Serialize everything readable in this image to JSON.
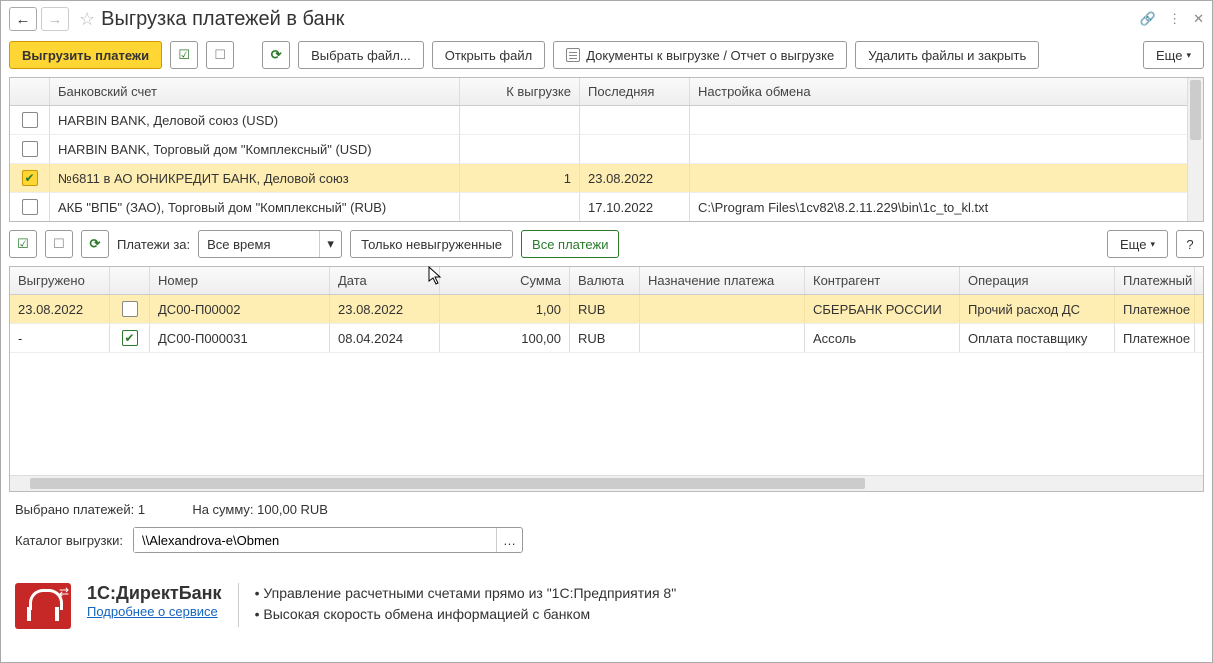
{
  "title": "Выгрузка платежей в банк",
  "toolbar": {
    "upload": "Выгрузить платежи",
    "select_file": "Выбрать файл...",
    "open_file": "Открыть файл",
    "docs_report": "Документы к выгрузке / Отчет о выгрузке",
    "delete_close": "Удалить файлы и закрыть",
    "more": "Еще"
  },
  "accounts": {
    "headers": {
      "acc": "Банковский счет",
      "upload": "К выгрузке",
      "last": "Последняя",
      "cfg": "Настройка обмена"
    },
    "rows": [
      {
        "checked": false,
        "acc": "HARBIN BANK, Деловой союз (USD)",
        "upload": "",
        "last": "",
        "cfg": ""
      },
      {
        "checked": false,
        "acc": "HARBIN BANK, Торговый дом \"Комплексный\" (USD)",
        "upload": "",
        "last": "",
        "cfg": ""
      },
      {
        "checked": true,
        "acc": "№6811 в АО ЮНИКРЕДИТ БАНК, Деловой союз",
        "upload": "1",
        "last": "23.08.2022",
        "cfg": "",
        "selected": true
      },
      {
        "checked": false,
        "acc": "АКБ \"ВПБ\" (ЗАО), Торговый дом \"Комплексный\" (RUB)",
        "upload": "",
        "last": "17.10.2022",
        "cfg": "C:\\Program Files\\1cv82\\8.2.11.229\\bin\\1c_to_kl.txt"
      }
    ]
  },
  "subbar": {
    "label": "Платежи за:",
    "period": "Все время",
    "only_not_uploaded": "Только невыгруженные",
    "all_payments": "Все платежи",
    "more": "Еще",
    "help": "?"
  },
  "payments": {
    "headers": {
      "up": "Выгружено",
      "num": "Номер",
      "date": "Дата",
      "sum": "Сумма",
      "cur": "Валюта",
      "purp": "Назначение платежа",
      "ctr": "Контрагент",
      "op": "Операция",
      "pay": "Платежный"
    },
    "rows": [
      {
        "up": "23.08.2022",
        "checked": false,
        "num": "ДС00-П00002",
        "date": "23.08.2022",
        "sum": "1,00",
        "cur": "RUB",
        "purp": "",
        "ctr": "СБЕРБАНК РОССИИ",
        "op": "Прочий расход ДС",
        "pay": "Платежное",
        "selected": true
      },
      {
        "up": "-",
        "checked": true,
        "num": "ДС00-П000031",
        "date": "08.04.2024",
        "sum": "100,00",
        "cur": "RUB",
        "purp": "",
        "ctr": "Ассоль",
        "op": "Оплата поставщику",
        "pay": "Платежное"
      }
    ]
  },
  "summary": {
    "selected_label": "Выбрано платежей:",
    "selected_count": "1",
    "sum_label": "На сумму:",
    "sum_value": "100,00 RUB"
  },
  "catalog": {
    "label": "Каталог выгрузки:",
    "path": "\\\\Alexandrova-e\\Obmen"
  },
  "promo": {
    "title": "1С:ДиректБанк",
    "link": "Подробнее о сервисе",
    "line1": "• Управление расчетными счетами прямо из \"1С:Предприятия 8\"",
    "line2": "• Высокая скорость обмена информацией с банком"
  }
}
